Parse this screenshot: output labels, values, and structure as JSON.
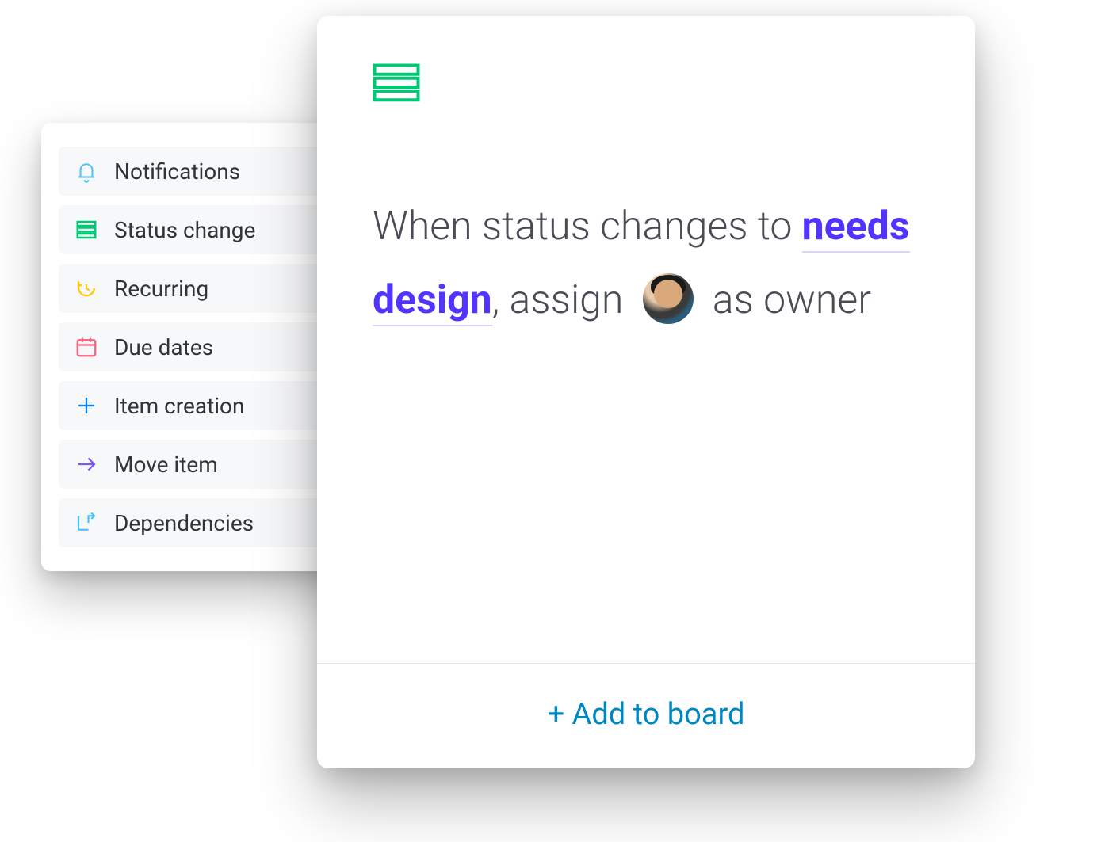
{
  "sidebar": {
    "items": [
      {
        "label": "Notifications",
        "icon": "bell-icon",
        "color": "#4ec2f7"
      },
      {
        "label": "Status change",
        "icon": "stack-icon",
        "color": "#00c875"
      },
      {
        "label": "Recurring",
        "icon": "clock-rewind-icon",
        "color": "#ffcb00"
      },
      {
        "label": "Due dates",
        "icon": "calendar-icon",
        "color": "#ff5e7c"
      },
      {
        "label": "Item creation",
        "icon": "plus-icon",
        "color": "#0086ff"
      },
      {
        "label": "Move item",
        "icon": "arrow-right-icon",
        "color": "#7b54ff"
      },
      {
        "label": "Dependencies",
        "icon": "dependency-icon",
        "color": "#4ec2f7"
      }
    ]
  },
  "automation": {
    "header_icon": "stack-icon",
    "header_icon_color": "#00c875",
    "text_prefix": "When status changes to ",
    "status_value": "needs design",
    "text_after_status": ", assign ",
    "text_suffix": " as owner",
    "assignee": "avatar"
  },
  "footer": {
    "add_label": "+ Add to board"
  }
}
